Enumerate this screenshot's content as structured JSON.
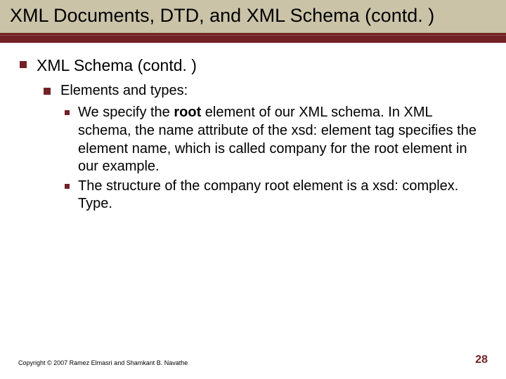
{
  "title": "XML Documents, DTD, and XML Schema (contd. )",
  "outline": {
    "l1": "XML Schema (contd. )",
    "l2": "Elements and types:",
    "l3a_pre": "We specify the ",
    "l3a_bold": "root",
    "l3a_post": " element of our XML schema. In XML schema, the name attribute of the xsd: element tag specifies the element name, which is called company for the root element in our example.",
    "l3b": "The structure of the company root element is a xsd: complex. Type."
  },
  "footer": {
    "copyright": "Copyright © 2007 Ramez Elmasri and Shamkant B. Navathe",
    "page": "28"
  }
}
